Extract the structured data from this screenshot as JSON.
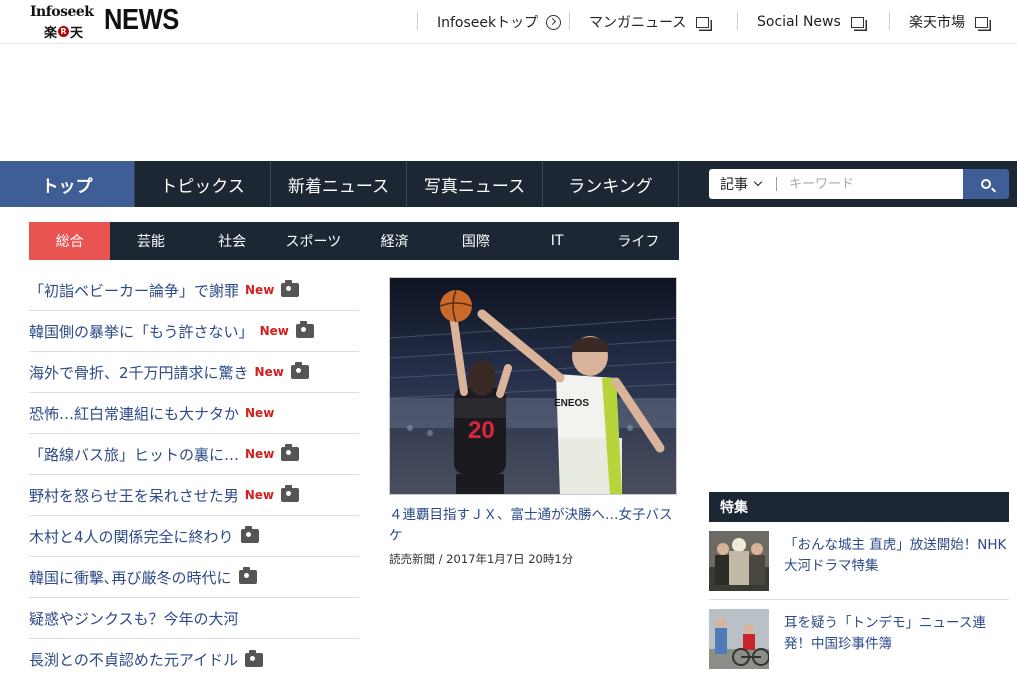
{
  "logo": {
    "infoseek": "Infoseek",
    "rakuten_left": "楽",
    "rakuten_r": "R",
    "rakuten_right": "天",
    "news": "NEWS"
  },
  "header_links": [
    {
      "label": "Infoseekトップ",
      "icon": "arrow-circle-icon"
    },
    {
      "label": "マンガニュース",
      "icon": "new-window-icon"
    },
    {
      "label": "Social News",
      "icon": "new-window-icon"
    },
    {
      "label": "楽天市場",
      "icon": "new-window-icon"
    }
  ],
  "nav": {
    "items": [
      {
        "label": "トップ",
        "active": true
      },
      {
        "label": "トピックス"
      },
      {
        "label": "新着ニュース"
      },
      {
        "label": "写真ニュース"
      },
      {
        "label": "ランキング"
      }
    ]
  },
  "search": {
    "select_label": "記事",
    "placeholder": "キーワード",
    "button_icon": "search-icon"
  },
  "categories": [
    {
      "label": "総合",
      "active": true
    },
    {
      "label": "芸能"
    },
    {
      "label": "社会"
    },
    {
      "label": "スポーツ"
    },
    {
      "label": "経済"
    },
    {
      "label": "国際"
    },
    {
      "label": "IT"
    },
    {
      "label": "ライフ"
    }
  ],
  "news": [
    {
      "title": "「初詣ベビーカー論争」で謝罪",
      "badge": "New",
      "camera": true
    },
    {
      "title": "韓国側の暴挙に「もう許さない」",
      "badge": "New",
      "camera": true
    },
    {
      "title": "海外で骨折、2千万円請求に驚き",
      "badge": "New",
      "camera": true
    },
    {
      "title": "恐怖…紅白常連組にも大ナタか",
      "badge": "New",
      "camera": false
    },
    {
      "title": "「路線バス旅」ヒットの裏に…",
      "badge": "New",
      "camera": true
    },
    {
      "title": "野村を怒らせ王を呆れさせた男",
      "badge": "New",
      "camera": true
    },
    {
      "title": "木村と4人の関係完全に終わり",
      "badge": "",
      "camera": true
    },
    {
      "title": "韓国に衝撃､再び厳冬の時代に",
      "badge": "",
      "camera": true
    },
    {
      "title": "疑惑やジンクスも？今年の大河",
      "badge": "",
      "camera": false
    },
    {
      "title": "長渕との不貞認めた元アイドル",
      "badge": "",
      "camera": true
    }
  ],
  "feature": {
    "title": "４連覇目指すＪＸ、富士通が決勝へ…女子バスケ",
    "meta": "読売新聞 / 2017年1月7日 20時1分",
    "photo_jersey_left": "20",
    "photo_jersey_right": "ENEOS"
  },
  "special": {
    "heading": "特集",
    "items": [
      {
        "title": "「おんな城主 直虎」放送開始！NHK大河ドラマ特集"
      },
      {
        "title": "耳を疑う「トンデモ」ニュース連発！中国珍事件簿"
      }
    ]
  }
}
